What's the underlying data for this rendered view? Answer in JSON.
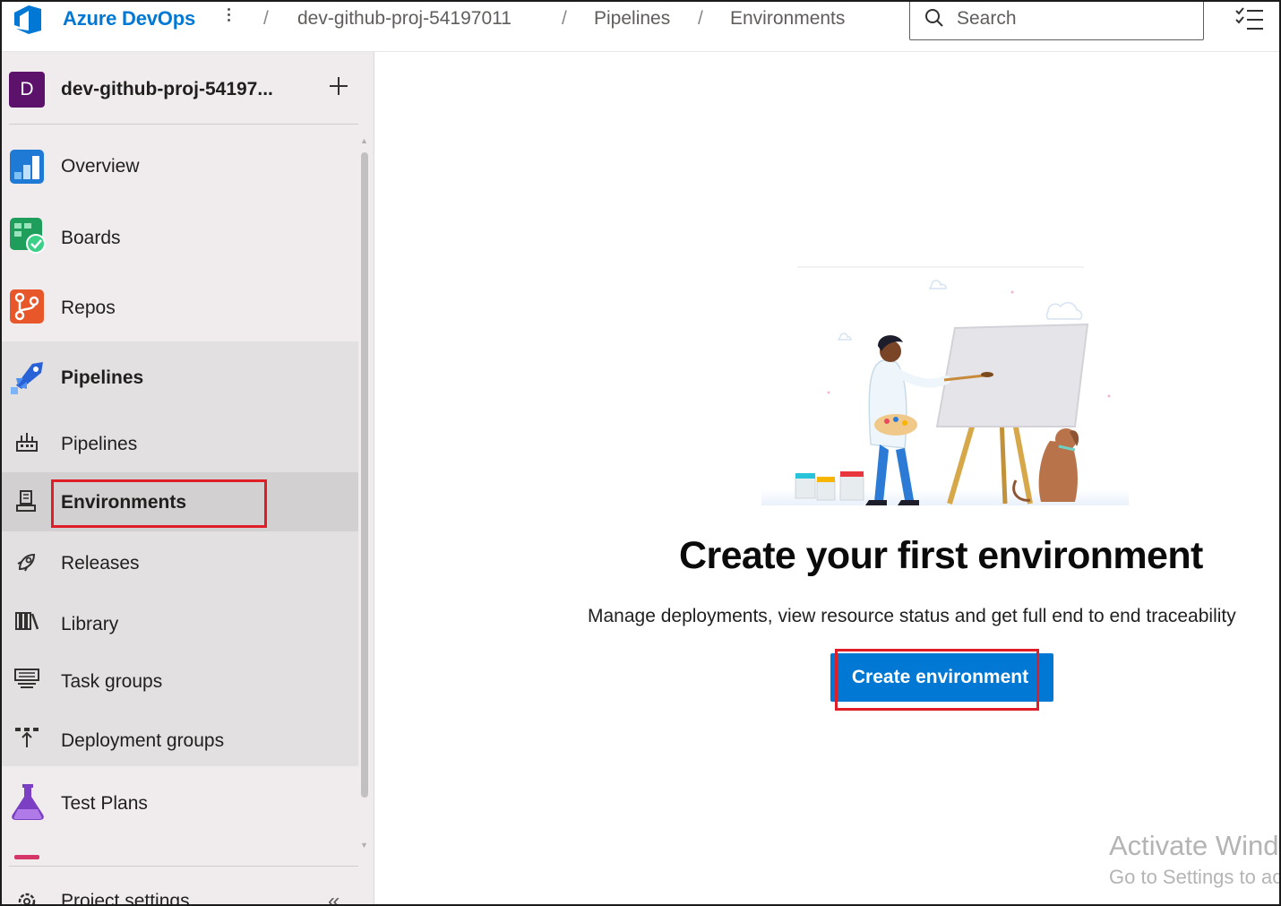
{
  "header": {
    "brand": "Azure DevOps",
    "breadcrumbs": [
      "dev-github-proj-54197011",
      "Pipelines",
      "Environments"
    ],
    "breadcrumb_separator": "/",
    "search_placeholder": "Search"
  },
  "project": {
    "avatar_letter": "D",
    "name": "dev-github-proj-54197...",
    "avatar_color": "#5c126b"
  },
  "sidebar": {
    "items": [
      {
        "label": "Overview",
        "icon": "overview-icon"
      },
      {
        "label": "Boards",
        "icon": "boards-icon"
      },
      {
        "label": "Repos",
        "icon": "repos-icon"
      },
      {
        "label": "Pipelines",
        "icon": "pipelines-icon"
      },
      {
        "label": "Pipelines",
        "icon": "pipelines-sub-icon"
      },
      {
        "label": "Environments",
        "icon": "environments-icon",
        "selected": true
      },
      {
        "label": "Releases",
        "icon": "releases-icon"
      },
      {
        "label": "Library",
        "icon": "library-icon"
      },
      {
        "label": "Task groups",
        "icon": "task-groups-icon"
      },
      {
        "label": "Deployment groups",
        "icon": "deployment-groups-icon"
      },
      {
        "label": "Test Plans",
        "icon": "test-plans-icon"
      },
      {
        "label": "Project settings",
        "icon": "gear-icon"
      }
    ],
    "collapse_glyph": "«"
  },
  "main": {
    "heading": "Create your first environment",
    "subtext": "Manage deployments, view resource status and get full end to end traceability",
    "create_button": "Create environment"
  },
  "watermark": {
    "line1": "Activate Windows",
    "line2": "Go to Settings to activate Windows."
  },
  "colors": {
    "accent": "#0078d4",
    "highlight_box": "#e01e28",
    "sidebar_bg": "#f0ecee"
  }
}
